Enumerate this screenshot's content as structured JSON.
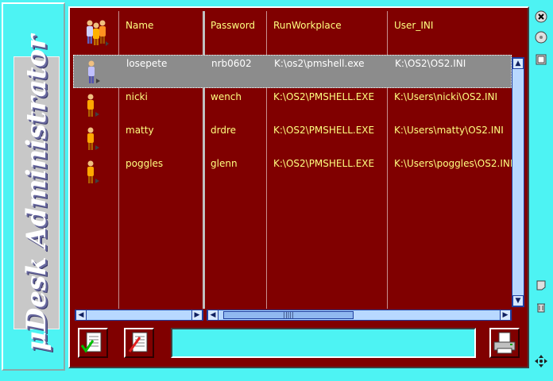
{
  "banner": {
    "text": "μDesk Administrator"
  },
  "columns": [
    "Name",
    "Password",
    "RunWorkplace",
    "User_INI"
  ],
  "users": [
    {
      "name": "losepete",
      "password": "nrb0602",
      "run_workplace": "K:\\os2\\pmshell.exe",
      "user_ini": "K:\\OS2\\OS2.INI",
      "selected": true
    },
    {
      "name": "nicki",
      "password": "wench",
      "run_workplace": "K:\\OS2\\PMSHELL.EXE",
      "user_ini": "K:\\Users\\nicki\\OS2.INI",
      "selected": false
    },
    {
      "name": "matty",
      "password": "drdre",
      "run_workplace": "K:\\OS2\\PMSHELL.EXE",
      "user_ini": "K:\\Users\\matty\\OS2.INI",
      "selected": false
    },
    {
      "name": "poggles",
      "password": "glenn",
      "run_workplace": "K:\\OS2\\PMSHELL.EXE",
      "user_ini": "K:\\Users\\poggles\\OS2.INI",
      "selected": false
    }
  ],
  "status": {
    "value": ""
  },
  "icons": {
    "apply": "check-document-icon",
    "edit": "pen-document-icon",
    "printer": "printer-icon",
    "close": "close-icon",
    "cd": "cd-icon",
    "window": "window-icon",
    "notes": "notes-icon",
    "trash": "trash-icon",
    "move": "move-arrows-icon"
  },
  "colors": {
    "background": "#4df3f3",
    "panel": "#800000",
    "text": "#ffff80",
    "selection": "#8c8c8c"
  }
}
